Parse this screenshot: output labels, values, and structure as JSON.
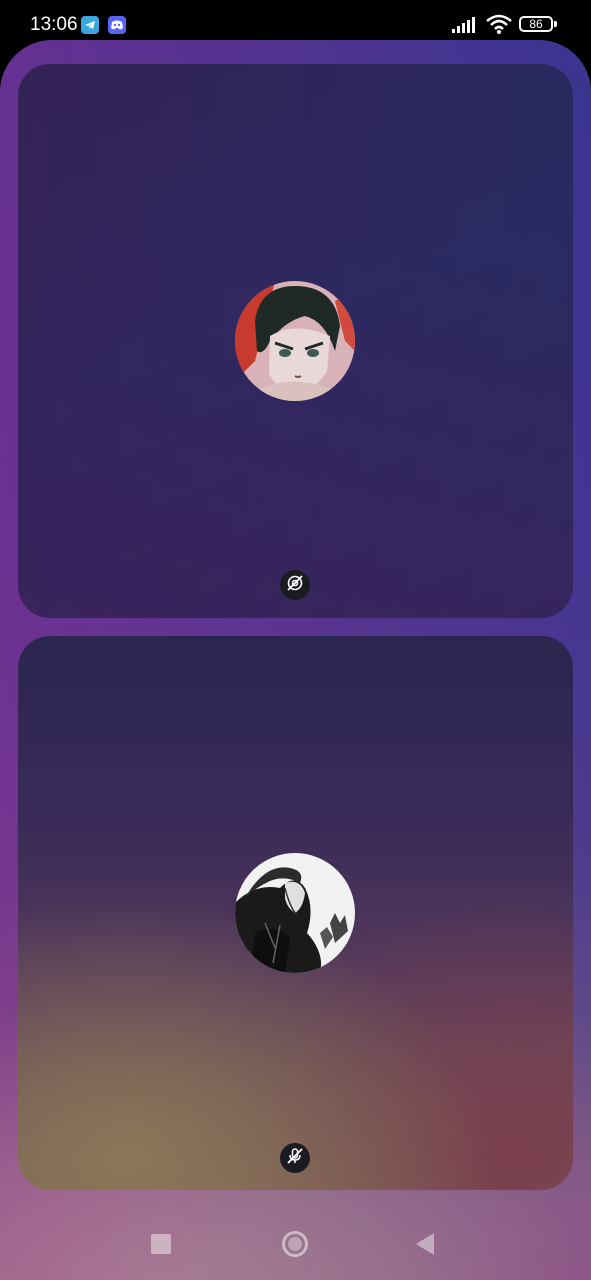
{
  "status_bar": {
    "time": "13:06",
    "notification_icons": [
      "telegram-icon",
      "discord-icon"
    ],
    "signal_icon": "signal-icon",
    "wifi_icon": "wifi-icon",
    "battery_level": "86"
  },
  "call": {
    "participants": [
      {
        "avatar_icon": "user-avatar-anime-girl",
        "status_icon": "video-off-icon",
        "status": "camera off"
      },
      {
        "avatar_icon": "user-avatar-samurai-manga",
        "status_icon": "mic-off-icon",
        "status": "muted"
      }
    ]
  },
  "nav_bar": {
    "recents_icon": "square-icon",
    "home_icon": "circle-icon",
    "back_icon": "triangle-back-icon"
  },
  "colors": {
    "background_top": "#4a2f8c",
    "background_bottom": "#f8d28f",
    "tile_top": "#2a2a5f",
    "badge": "#1b1b22"
  }
}
